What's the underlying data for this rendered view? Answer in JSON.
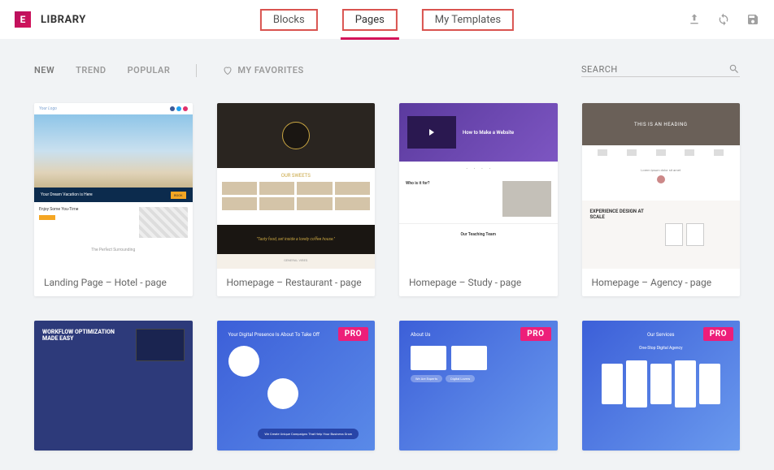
{
  "header": {
    "title": "LIBRARY",
    "tabs": [
      "Blocks",
      "Pages",
      "My Templates"
    ],
    "active_tab_index": 1
  },
  "filters": {
    "items": [
      "NEW",
      "TREND",
      "POPULAR"
    ],
    "favorites_label": "MY FAVORITES",
    "search_placeholder": "SEARCH"
  },
  "templates_row1": [
    {
      "caption": "Landing Page – Hotel - page"
    },
    {
      "caption": "Homepage – Restaurant - page"
    },
    {
      "caption": "Homepage – Study - page"
    },
    {
      "caption": "Homepage – Agency - page"
    }
  ],
  "templates_row2": [
    {
      "pro": false
    },
    {
      "pro": true,
      "pro_label": "PRO"
    },
    {
      "pro": true,
      "pro_label": "PRO"
    },
    {
      "pro": true,
      "pro_label": "PRO"
    }
  ],
  "thumb_text": {
    "t1_logo": "Your Logo",
    "t1_bar": "Your Dream Vacation is Here",
    "t1_sec": "Enjoy Some You-Time",
    "t1_foot": "The Perfect Surrounding",
    "t2_sweets": "OUR SWEETS",
    "t2_quote": "\"Tasty food, set inside a lovely coffee house.\"",
    "t2_foot": "GENERAL VIBES",
    "t3_hero": "How to Make a Website",
    "t3_who": "Who is it for?",
    "t3_team": "Our Teaching Team",
    "t4_hero": "THIS IS AN HEADING",
    "t4_exp": "EXPERIENCE DESIGN AT SCALE",
    "b1_title": "WORKFLOW OPTIMIZATION MADE EASY",
    "b2_title": "Your Digital Presence Is About To Take Off",
    "b2_pill1": "We Create Unique Campaigns That Help Your Business Grow",
    "b3_title": "About Us",
    "b3_tag1": "We Are Experts",
    "b3_tag2": "Digital Lovers",
    "b4_title": "Our Services",
    "b4_sub": "One-Stop Digital Agency"
  }
}
